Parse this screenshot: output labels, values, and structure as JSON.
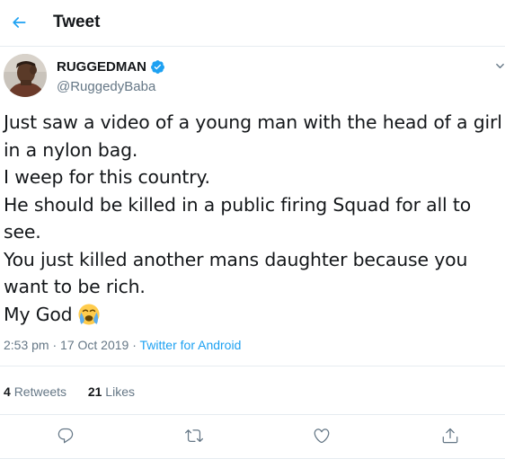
{
  "header": {
    "title": "Tweet"
  },
  "author": {
    "name": "RUGGEDMAN",
    "handle": "@RuggedyBaba"
  },
  "tweet": {
    "lines": [
      "Just saw a video of a young man with the head of a girl",
      "in a nylon bag.",
      "I weep for this country.",
      "He should be killed in a public firing Squad for all to",
      "see.",
      "You just killed another mans daughter because you",
      "want to be rich.",
      "My God"
    ]
  },
  "meta": {
    "time": "2:53 pm",
    "date": "17 Oct 2019",
    "separator": "·",
    "source": "Twitter for Android"
  },
  "stats": {
    "retweets_count": "4",
    "retweets_label": "Retweets",
    "likes_count": "21",
    "likes_label": "Likes"
  },
  "icons": {
    "back": "arrow-left-icon",
    "verified": "verified-badge-icon",
    "caret": "chevron-down-icon",
    "emoji": "loudly-crying-face-emoji",
    "reply": "reply-icon",
    "retweet": "retweet-icon",
    "like": "heart-icon",
    "share": "share-icon"
  },
  "colors": {
    "accent": "#1da1f2",
    "text": "#14171a",
    "secondary": "#657786",
    "border": "#e6ecf0"
  }
}
